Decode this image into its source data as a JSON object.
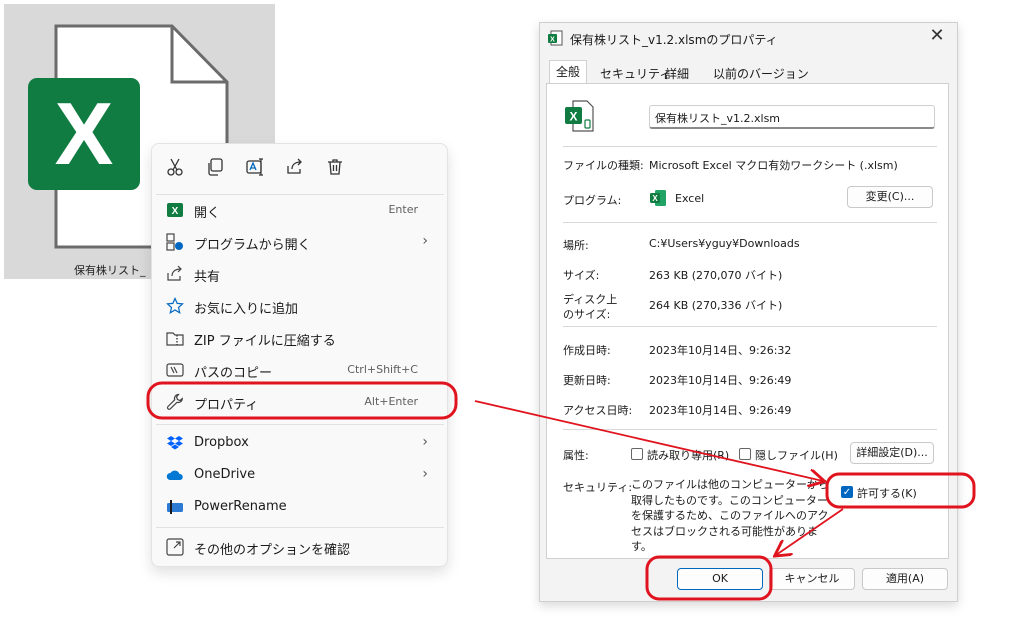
{
  "file_tile": {
    "label": "保有株リスト_",
    "icon": "excel-file-icon",
    "logo_letter": "X"
  },
  "context_menu": {
    "top_actions": [
      {
        "icon": "cut-icon"
      },
      {
        "icon": "copy-icon"
      },
      {
        "icon": "rename-icon"
      },
      {
        "icon": "share-icon"
      },
      {
        "icon": "delete-icon"
      }
    ],
    "items": [
      {
        "label": "開く",
        "shortcut": "Enter",
        "icon": "excel-icon"
      },
      {
        "label": "プログラムから開く",
        "submenu": "›",
        "icon": "open-with-icon"
      },
      {
        "label": "共有",
        "icon": "share-icon"
      },
      {
        "label": "お気に入りに追加",
        "icon": "star-icon"
      },
      {
        "label": "ZIP ファイルに圧縮する",
        "icon": "zip-icon"
      },
      {
        "label": "パスのコピー",
        "shortcut": "Ctrl+Shift+C",
        "icon": "copy-path-icon"
      },
      {
        "label": "プロパティ",
        "shortcut": "Alt+Enter",
        "icon": "wrench-icon"
      },
      {
        "label": "Dropbox",
        "submenu": "›",
        "icon": "dropbox-icon"
      },
      {
        "label": "OneDrive",
        "submenu": "›",
        "icon": "onedrive-icon"
      },
      {
        "label": "PowerRename",
        "icon": "powerrename-icon"
      },
      {
        "label": "その他のオプションを確認",
        "icon": "more-options-icon"
      }
    ]
  },
  "dialog": {
    "title": "保有株リスト_v1.2.xlsmのプロパティ",
    "close_glyph": "✕",
    "tabs": [
      "全般",
      "セキュリティ",
      "詳細",
      "以前のバージョン"
    ],
    "active_tab": "全般",
    "filename": "保有株リスト_v1.2.xlsm",
    "file_type_label": "ファイルの種類:",
    "file_type_value": "Microsoft Excel マクロ有効ワークシート (.xlsm)",
    "program_label": "プログラム:",
    "program_value": "Excel",
    "change_button": "変更(C)...",
    "location_label": "場所:",
    "location_value": "C:¥Users¥yguy¥Downloads",
    "size_label": "サイズ:",
    "size_value": "263 KB (270,070 バイト)",
    "disk_size_label_1": "ディスク上",
    "disk_size_label_2": "のサイズ:",
    "disk_size_value": "264 KB (270,336 バイト)",
    "created_label": "作成日時:",
    "created_value": "2023年10月14日、9:26:32",
    "modified_label": "更新日時:",
    "modified_value": "2023年10月14日、9:26:49",
    "accessed_label": "アクセス日時:",
    "accessed_value": "2023年10月14日、9:26:49",
    "attributes_label": "属性:",
    "readonly_label": "読み取り専用(R)",
    "hidden_label": "隠しファイル(H)",
    "advanced_button": "詳細設定(D)...",
    "security_label": "セキュリティ:",
    "security_text": "このファイルは他のコンピューターから取得したものです。このコンピューターを保護するため、このファイルへのアクセスはブロックされる可能性があります。",
    "unblock_label": "許可する(K)",
    "unblock_checked": true,
    "ok_button": "OK",
    "cancel_button": "キャンセル",
    "apply_button": "適用(A)"
  },
  "colors": {
    "excel_green": "#107c41",
    "annotation_red": "#e0141e",
    "checkbox_blue": "#0067c0"
  }
}
